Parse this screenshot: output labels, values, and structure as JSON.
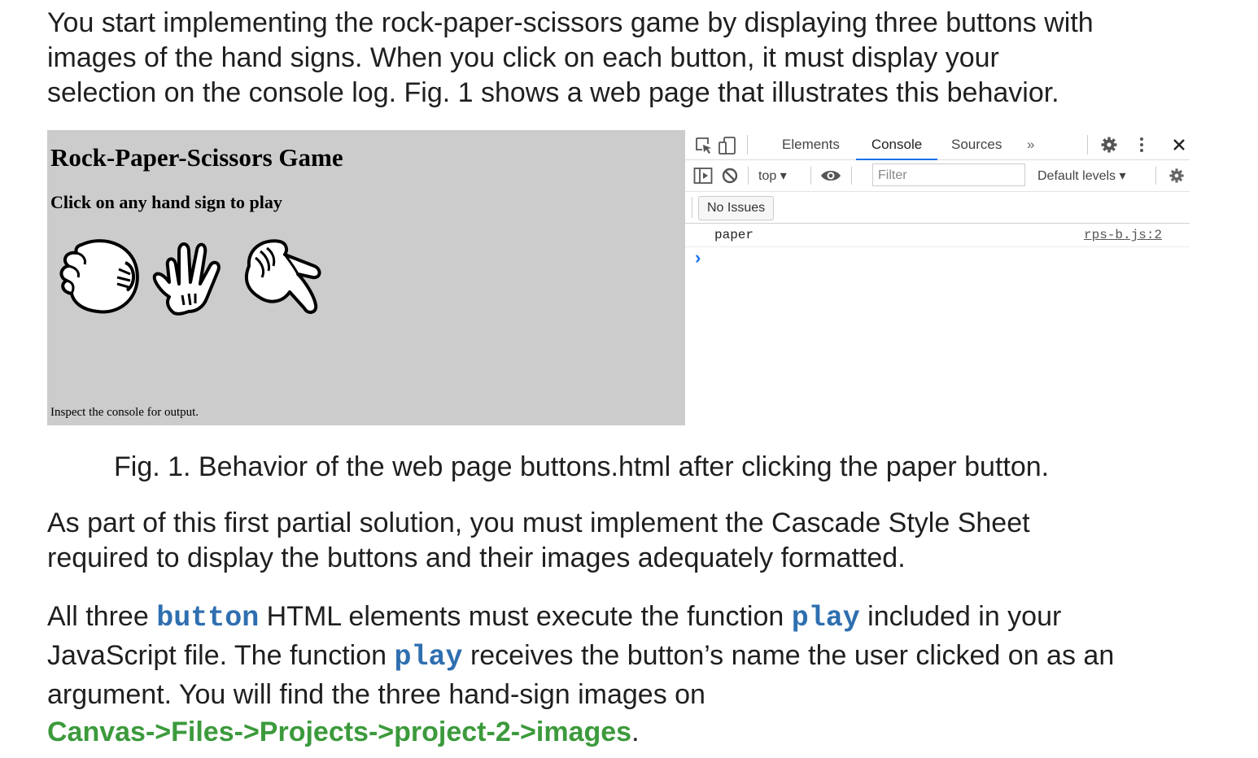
{
  "intro": {
    "line1": "You start implementing the rock-paper-scissors game by displaying three buttons with",
    "line2": "images of the hand signs. When you click on each button, it must display your",
    "line3": "selection on the console log. Fig. 1 shows a web page that illustrates this behavior."
  },
  "game": {
    "title": "Rock-Paper-Scissors Game",
    "subtitle": "Click on any hand sign to play",
    "footer": "Inspect the console for output."
  },
  "devtools": {
    "tabs": [
      "Elements",
      "Console",
      "Sources",
      "»"
    ],
    "context": "top ▾",
    "filter_placeholder": "Filter",
    "levels": "Default levels ▾",
    "issues": "No Issues",
    "log_message": "paper",
    "log_source": "rps-b.js:2",
    "prompt": "›",
    "accent": "#1a73e8"
  },
  "caption": "Fig. 1. Behavior of the web page buttons.html after clicking the paper button.",
  "para2": {
    "line1": "As part of this first partial solution, you must implement the Cascade Style Sheet",
    "line2": "required to display the buttons and their images adequately formatted."
  },
  "para3": {
    "t1": "All three ",
    "code1": "button",
    "t2": " HTML elements must execute the function ",
    "code2": "play",
    "t3": " included in your",
    "t4": "JavaScript file. The function ",
    "code3": "play",
    "t5": " receives the button’s name the user clicked on as an",
    "t6": "argument. You will find the three hand-sign images on",
    "path": "Canvas->Files->Projects->project-2->images",
    "t7": "."
  },
  "colors": {
    "code": "#2f6fb0",
    "path": "#3c9a3c",
    "game_bg": "#cccccc"
  }
}
